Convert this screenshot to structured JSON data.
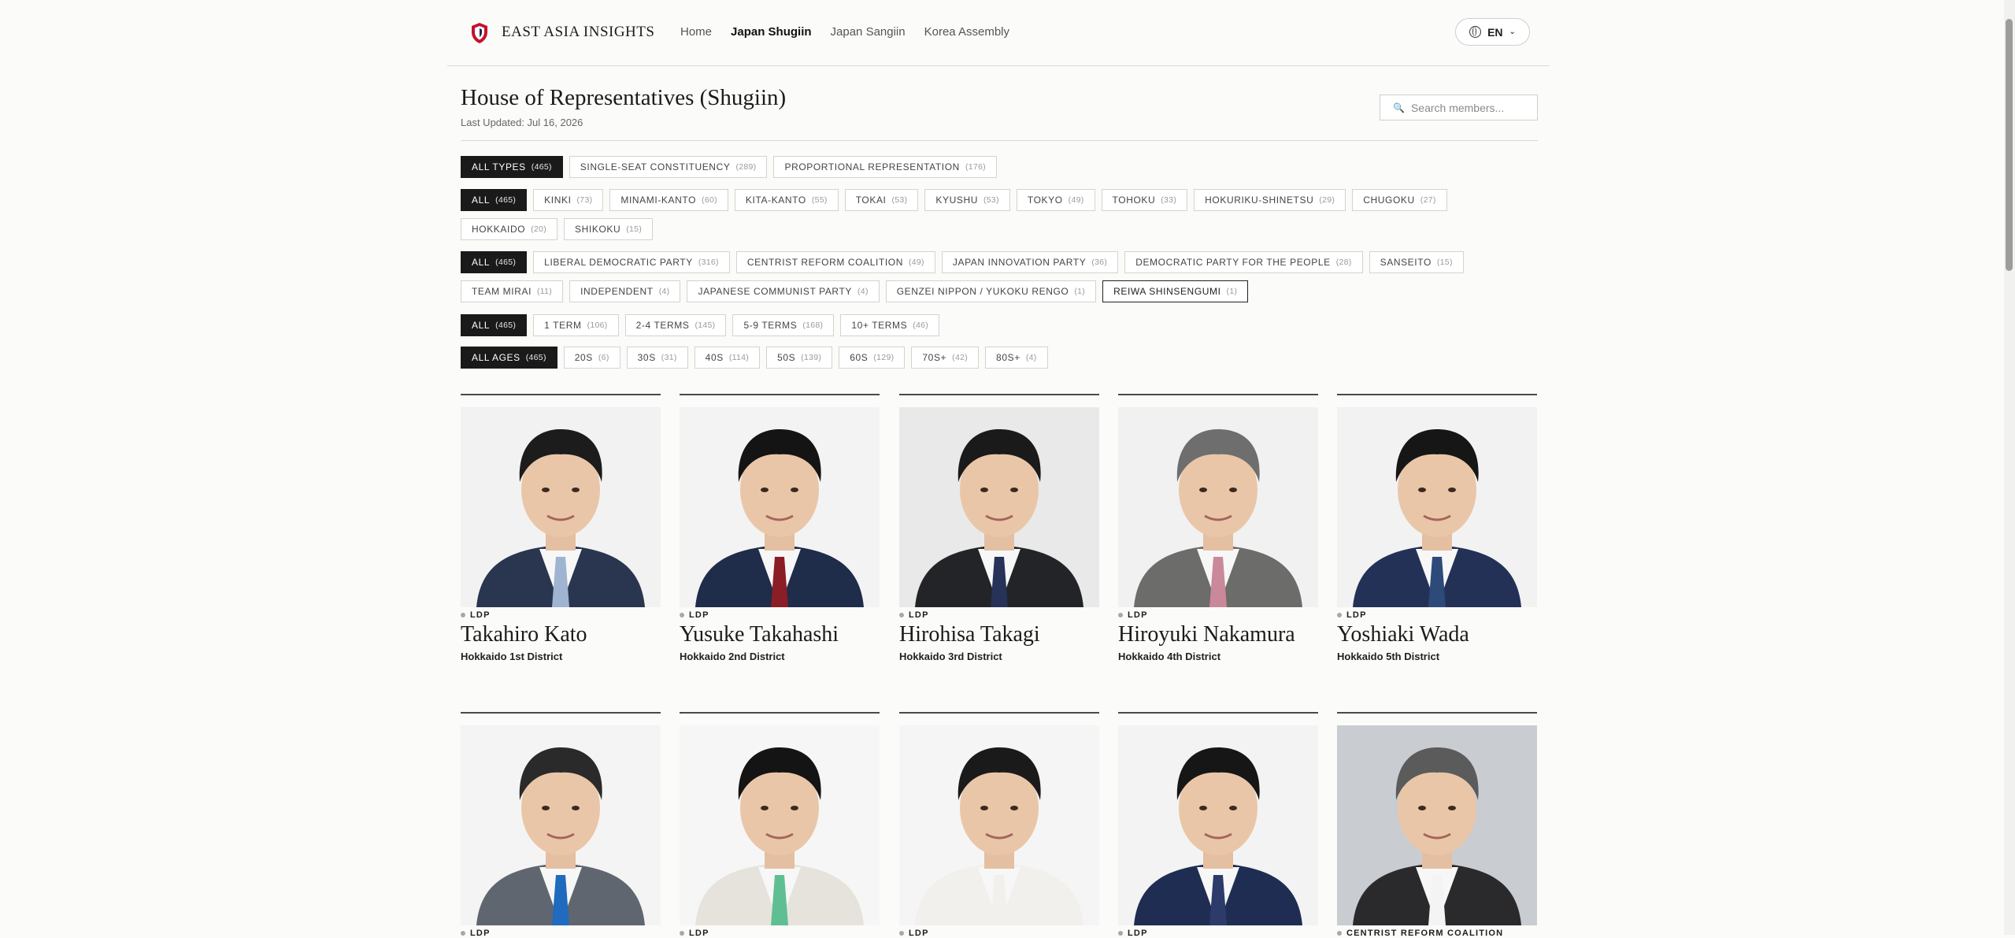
{
  "header": {
    "brand": "EAST ASIA INSIGHTS",
    "nav": [
      "Home",
      "Japan Shugiin",
      "Japan Sangiin",
      "Korea Assembly"
    ],
    "nav_active": "Japan Shugiin",
    "language": "EN"
  },
  "page": {
    "title": "House of Representatives (Shugiin)",
    "updated": "Last Updated: Jul 16, 2026",
    "search_placeholder": "Search members..."
  },
  "filters": {
    "types": [
      {
        "label": "ALL TYPES",
        "count": "(465)",
        "active": true
      },
      {
        "label": "SINGLE-SEAT CONSTITUENCY",
        "count": "(289)"
      },
      {
        "label": "PROPORTIONAL REPRESENTATION",
        "count": "(176)"
      }
    ],
    "regions": [
      {
        "label": "ALL",
        "count": "(465)",
        "active": true
      },
      {
        "label": "KINKI",
        "count": "(73)"
      },
      {
        "label": "MINAMI-KANTO",
        "count": "(60)"
      },
      {
        "label": "KITA-KANTO",
        "count": "(55)"
      },
      {
        "label": "TOKAI",
        "count": "(53)"
      },
      {
        "label": "KYUSHU",
        "count": "(53)"
      },
      {
        "label": "TOKYO",
        "count": "(49)"
      },
      {
        "label": "TOHOKU",
        "count": "(33)"
      },
      {
        "label": "HOKURIKU-SHINETSU",
        "count": "(29)"
      },
      {
        "label": "CHUGOKU",
        "count": "(27)"
      },
      {
        "label": "HOKKAIDO",
        "count": "(20)"
      },
      {
        "label": "SHIKOKU",
        "count": "(15)"
      }
    ],
    "parties": [
      {
        "label": "ALL",
        "count": "(465)",
        "active": true
      },
      {
        "label": "LIBERAL DEMOCRATIC PARTY",
        "count": "(316)"
      },
      {
        "label": "CENTRIST REFORM COALITION",
        "count": "(49)"
      },
      {
        "label": "JAPAN INNOVATION PARTY",
        "count": "(36)"
      },
      {
        "label": "DEMOCRATIC PARTY FOR THE PEOPLE",
        "count": "(28)"
      },
      {
        "label": "SANSEITO",
        "count": "(15)"
      },
      {
        "label": "TEAM MIRAI",
        "count": "(11)"
      },
      {
        "label": "INDEPENDENT",
        "count": "(4)"
      },
      {
        "label": "JAPANESE COMMUNIST PARTY",
        "count": "(4)"
      },
      {
        "label": "GENZEI NIPPON / YUKOKU RENGO",
        "count": "(1)"
      },
      {
        "label": "REIWA SHINSENGUMI",
        "count": "(1)",
        "outlined": true
      }
    ],
    "terms": [
      {
        "label": "ALL",
        "count": "(465)",
        "active": true
      },
      {
        "label": "1 TERM",
        "count": "(106)"
      },
      {
        "label": "2-4 TERMS",
        "count": "(145)"
      },
      {
        "label": "5-9 TERMS",
        "count": "(168)"
      },
      {
        "label": "10+ TERMS",
        "count": "(46)"
      }
    ],
    "ages": [
      {
        "label": "ALL AGES",
        "count": "(465)",
        "active": true
      },
      {
        "label": "20S",
        "count": "(6)"
      },
      {
        "label": "30S",
        "count": "(31)"
      },
      {
        "label": "40S",
        "count": "(114)"
      },
      {
        "label": "50S",
        "count": "(139)"
      },
      {
        "label": "60S",
        "count": "(129)"
      },
      {
        "label": "70S+",
        "count": "(42)"
      },
      {
        "label": "80S+",
        "count": "(4)"
      }
    ]
  },
  "members": [
    {
      "party": "LDP",
      "name": "Takahiro Kato",
      "district": "Hokkaido 1st District",
      "suit": "#2a3550",
      "tie": "#9fb4d0",
      "bg": "#f2f2f2",
      "hair": "#1c1c1c"
    },
    {
      "party": "LDP",
      "name": "Yusuke Takahashi",
      "district": "Hokkaido 2nd District",
      "suit": "#1f2c4a",
      "tie": "#8b1d26",
      "bg": "#f3f3f3",
      "hair": "#141414"
    },
    {
      "party": "LDP",
      "name": "Hirohisa Takagi",
      "district": "Hokkaido 3rd District",
      "suit": "#222428",
      "tie": "#263257",
      "bg": "#e9e9e9",
      "hair": "#1a1a1a"
    },
    {
      "party": "LDP",
      "name": "Hiroyuki Nakamura",
      "district": "Hokkaido 4th District",
      "suit": "#6c6c6a",
      "tie": "#c9899a",
      "bg": "#f1f1f1",
      "hair": "#6e6e6e"
    },
    {
      "party": "LDP",
      "name": "Yoshiaki Wada",
      "district": "Hokkaido 5th District",
      "suit": "#233157",
      "tie": "#2d4a7a",
      "bg": "#f2f2f2",
      "hair": "#161616"
    },
    {
      "party": "LDP",
      "name": "",
      "district": "",
      "suit": "#60666f",
      "tie": "#1f6bbd",
      "bg": "#f4f4f4",
      "hair": "#2a2a2a"
    },
    {
      "party": "LDP",
      "name": "",
      "district": "",
      "suit": "#e6e3dc",
      "tie": "#5fbf93",
      "bg": "#f6f6f6",
      "hair": "#141414"
    },
    {
      "party": "LDP",
      "name": "",
      "district": "",
      "suit": "#f2f0ec",
      "tie": "#f2f0ec",
      "bg": "#f5f5f5",
      "hair": "#1a1a1a"
    },
    {
      "party": "LDP",
      "name": "",
      "district": "",
      "suit": "#1f2d52",
      "tie": "#2c3b6a",
      "bg": "#f3f3f3",
      "hair": "#161616"
    },
    {
      "party": "CENTRIST REFORM COALITION",
      "name": "",
      "district": "",
      "suit": "#2a2a2c",
      "tie": "#f4f4f4",
      "bg": "#c9ccd1",
      "hair": "#5b5b5b"
    }
  ]
}
